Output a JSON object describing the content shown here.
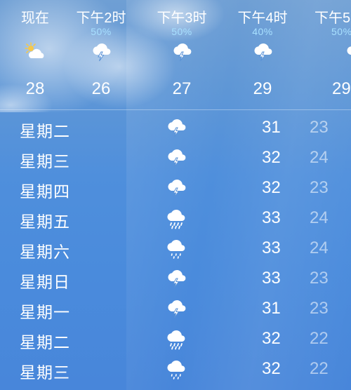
{
  "hourly": [
    {
      "label": "现在",
      "pop": "",
      "icon": "partly-sunny-icon",
      "temp": "28"
    },
    {
      "label": "下午2时",
      "pop": "50%",
      "icon": "thunderstorm-icon",
      "temp": "26"
    },
    {
      "label": "下午3时",
      "pop": "50%",
      "icon": "thunderstorm-icon",
      "temp": "27"
    },
    {
      "label": "下午4时",
      "pop": "40%",
      "icon": "thunderstorm-icon",
      "temp": "29"
    },
    {
      "label": "下午5",
      "pop": "50%",
      "icon": "thunderstorm-icon",
      "temp": "29"
    }
  ],
  "daily": [
    {
      "day": "星期二",
      "icon": "thunderstorm-icon",
      "high": "31",
      "low": "23"
    },
    {
      "day": "星期三",
      "icon": "thunderstorm-icon",
      "high": "32",
      "low": "24"
    },
    {
      "day": "星期四",
      "icon": "thunderstorm-icon",
      "high": "32",
      "low": "23"
    },
    {
      "day": "星期五",
      "icon": "rain-icon",
      "high": "33",
      "low": "24"
    },
    {
      "day": "星期六",
      "icon": "drizzle-icon",
      "high": "33",
      "low": "24"
    },
    {
      "day": "星期日",
      "icon": "thunderstorm-icon",
      "high": "33",
      "low": "23"
    },
    {
      "day": "星期一",
      "icon": "thunderstorm-icon",
      "high": "31",
      "low": "23"
    },
    {
      "day": "星期二",
      "icon": "rain-icon",
      "high": "32",
      "low": "22"
    },
    {
      "day": "星期三",
      "icon": "drizzle-icon",
      "high": "32",
      "low": "22"
    }
  ],
  "colors": {
    "precipitation": "#a8e0ff",
    "sun": "#f6c84a",
    "low_temp": "rgba(255,255,255,0.55)"
  }
}
